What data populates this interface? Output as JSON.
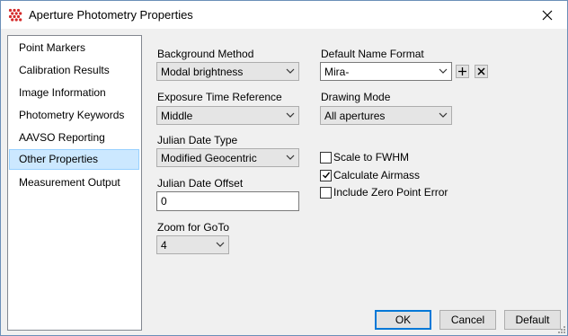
{
  "window": {
    "title": "Aperture Photometry Properties"
  },
  "sidebar": {
    "items": [
      {
        "label": "Point Markers"
      },
      {
        "label": "Calibration Results"
      },
      {
        "label": "Image Information"
      },
      {
        "label": "Photometry Keywords"
      },
      {
        "label": "AAVSO Reporting"
      },
      {
        "label": "Other Properties",
        "selected": true
      },
      {
        "label": "Measurement Output"
      }
    ]
  },
  "form": {
    "background_method": {
      "label": "Background Method",
      "value": "Modal brightness"
    },
    "exposure_time_reference": {
      "label": "Exposure Time Reference",
      "value": "Middle"
    },
    "julian_date_type": {
      "label": "Julian Date Type",
      "value": "Modified Geocentric"
    },
    "julian_date_offset": {
      "label": "Julian Date Offset",
      "value": "0"
    },
    "zoom_for_goto": {
      "label": "Zoom for GoTo",
      "value": "4"
    },
    "default_name_format": {
      "label": "Default Name Format",
      "value": "Mira-"
    },
    "drawing_mode": {
      "label": "Drawing Mode",
      "value": "All apertures"
    },
    "scale_to_fwhm": {
      "label": "Scale to FWHM",
      "checked": false
    },
    "calculate_airmass": {
      "label": "Calculate Airmass",
      "checked": true
    },
    "include_zero_point_error": {
      "label": "Include Zero Point Error",
      "checked": false
    }
  },
  "buttons": {
    "ok": "OK",
    "cancel": "Cancel",
    "default": "Default"
  },
  "colors": {
    "selection_bg": "#cce8ff",
    "selection_border": "#99d1ff",
    "icon_red": "#d42a2a"
  },
  "icons": {
    "app": "red-dot-grid-icon",
    "close": "close-icon",
    "add": "plus-icon",
    "remove": "x-icon",
    "dropdown": "chevron-down-icon",
    "check": "checkmark-icon"
  }
}
